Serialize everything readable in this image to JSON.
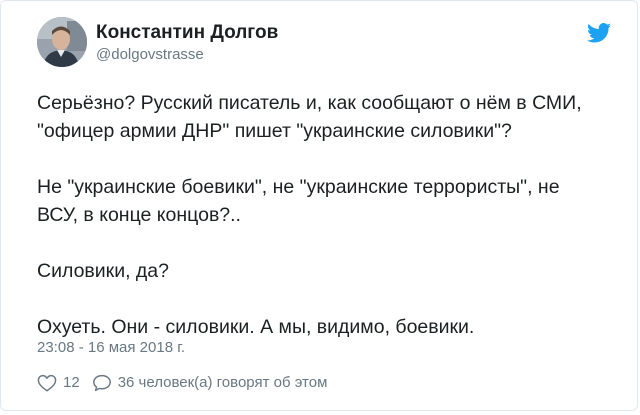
{
  "author": {
    "display_name": "Константин Долгов",
    "handle": "@dolgovstrasse"
  },
  "tweet": {
    "paragraphs": [
      "Серьёзно? Русский писатель и, как сообщают о нём в СМИ,\n\"офицер армии ДНР\" пишет \"украинские силовики\"?",
      "Не \"украинские боевики\", не \"украинские террористы\", не\nВСУ, в конце концов?..",
      "Силовики, да?",
      "Охуеть. Они - силовики. А мы, видимо, боевики."
    ],
    "timestamp": "23:08 - 16 мая 2018 г."
  },
  "actions": {
    "likes": "12",
    "talking": "36 человек(а) говорят об этом"
  },
  "icons": {
    "brand": "twitter-bird-icon",
    "like": "heart-icon",
    "reply": "speech-bubble-icon"
  },
  "colors": {
    "text": "#1c2022",
    "secondary": "#697882",
    "twitter_blue": "#1da1f2",
    "border": "#e1e8ed"
  }
}
